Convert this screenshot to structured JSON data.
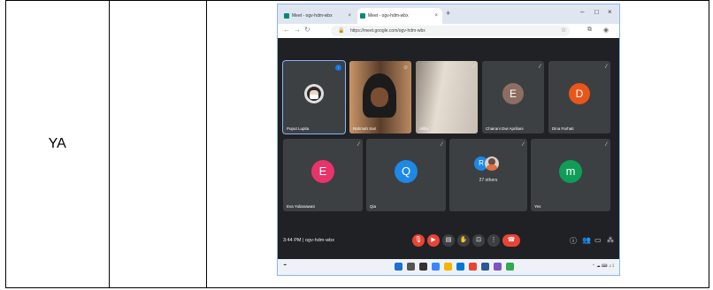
{
  "table": {
    "col1_text": "YA",
    "col2_text": ""
  },
  "browser": {
    "tabs": [
      {
        "label": "Meet - ogv-hdm-wbx"
      },
      {
        "label": "Meet - ogv-hdm-wbx"
      }
    ],
    "url": "https://meet.google.com/ogv-hdm-wbx"
  },
  "meeting": {
    "participants_row1": [
      {
        "name": "Puput Lupita",
        "initial": ""
      },
      {
        "name": "Rahmah Sari",
        "initial": ""
      },
      {
        "name": "Alifia",
        "initial": ""
      },
      {
        "name": "Chairani Dwi Apriliani",
        "initial": "E"
      },
      {
        "name": "Dina Farhati",
        "initial": "D"
      }
    ],
    "participants_row2": [
      {
        "name": "Eva Yulianawati",
        "initial": "E"
      },
      {
        "name": "Qia",
        "initial": "Q"
      },
      {
        "name": "",
        "initial": "R",
        "others": "27 others"
      },
      {
        "name": "Yes",
        "initial": "m"
      }
    ],
    "time": "3:44 PM",
    "meeting_code": "ogv-hdm-wbx"
  },
  "colors": {
    "E1": "#8d6e63",
    "D": "#e8561a",
    "E2": "#e8336b",
    "Q": "#1e88e5",
    "R": "#1e88e5",
    "m": "#0f9d58"
  }
}
